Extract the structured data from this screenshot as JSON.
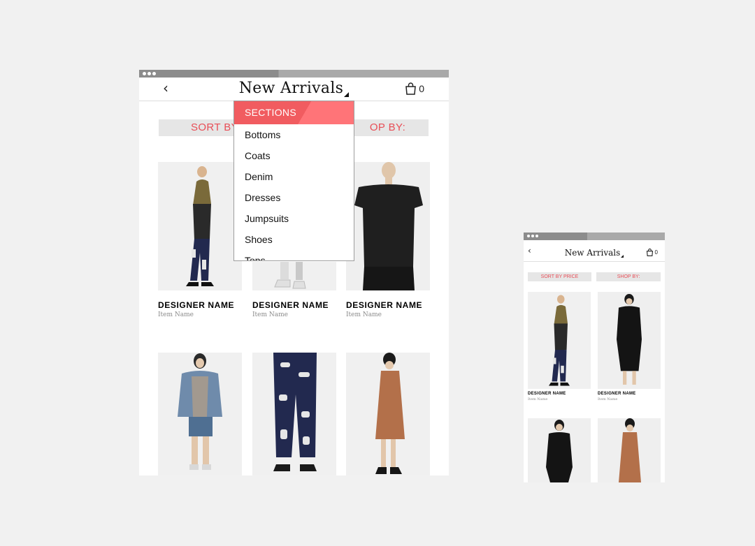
{
  "large": {
    "header": {
      "back_icon": "‹",
      "title": "New Arrivals",
      "cart_count": "0"
    },
    "filters": {
      "sort_label": "SORT BY",
      "shop_label": "OP BY:"
    },
    "dropdown": {
      "heading": "SECTIONS",
      "items": [
        "Bottoms",
        "Coats",
        "Denim",
        "Dresses",
        "Jumpsuits",
        "Shoes",
        "Tops"
      ]
    },
    "products": [
      {
        "designer": "DESIGNER NAME",
        "item": "Item Name"
      },
      {
        "designer": "DESIGNER NAME",
        "item": "Item Name"
      },
      {
        "designer": "DESIGNER NAME",
        "item": "Item Name"
      },
      {
        "designer": "",
        "item": ""
      },
      {
        "designer": "",
        "item": ""
      },
      {
        "designer": "",
        "item": ""
      }
    ]
  },
  "small": {
    "header": {
      "back_icon": "‹",
      "title": "New Arrivals",
      "cart_count": "0"
    },
    "filters": {
      "sort_label": "SORT BY PRICE",
      "shop_label": "SHOP BY:"
    },
    "products": [
      {
        "designer": "DESIGNER NAME",
        "item": "Item Name"
      },
      {
        "designer": "DESIGNER NAME",
        "item": "Item Name"
      }
    ]
  },
  "icons": {
    "bag": "shopping-bag-icon",
    "back": "chevron-left-icon",
    "caret": "dropdown-caret-icon"
  },
  "colors": {
    "accent": "#e84e57",
    "dropdown_header": "#f15c60",
    "chrome": "#8c8c8c",
    "background": "#f1f1f1"
  }
}
